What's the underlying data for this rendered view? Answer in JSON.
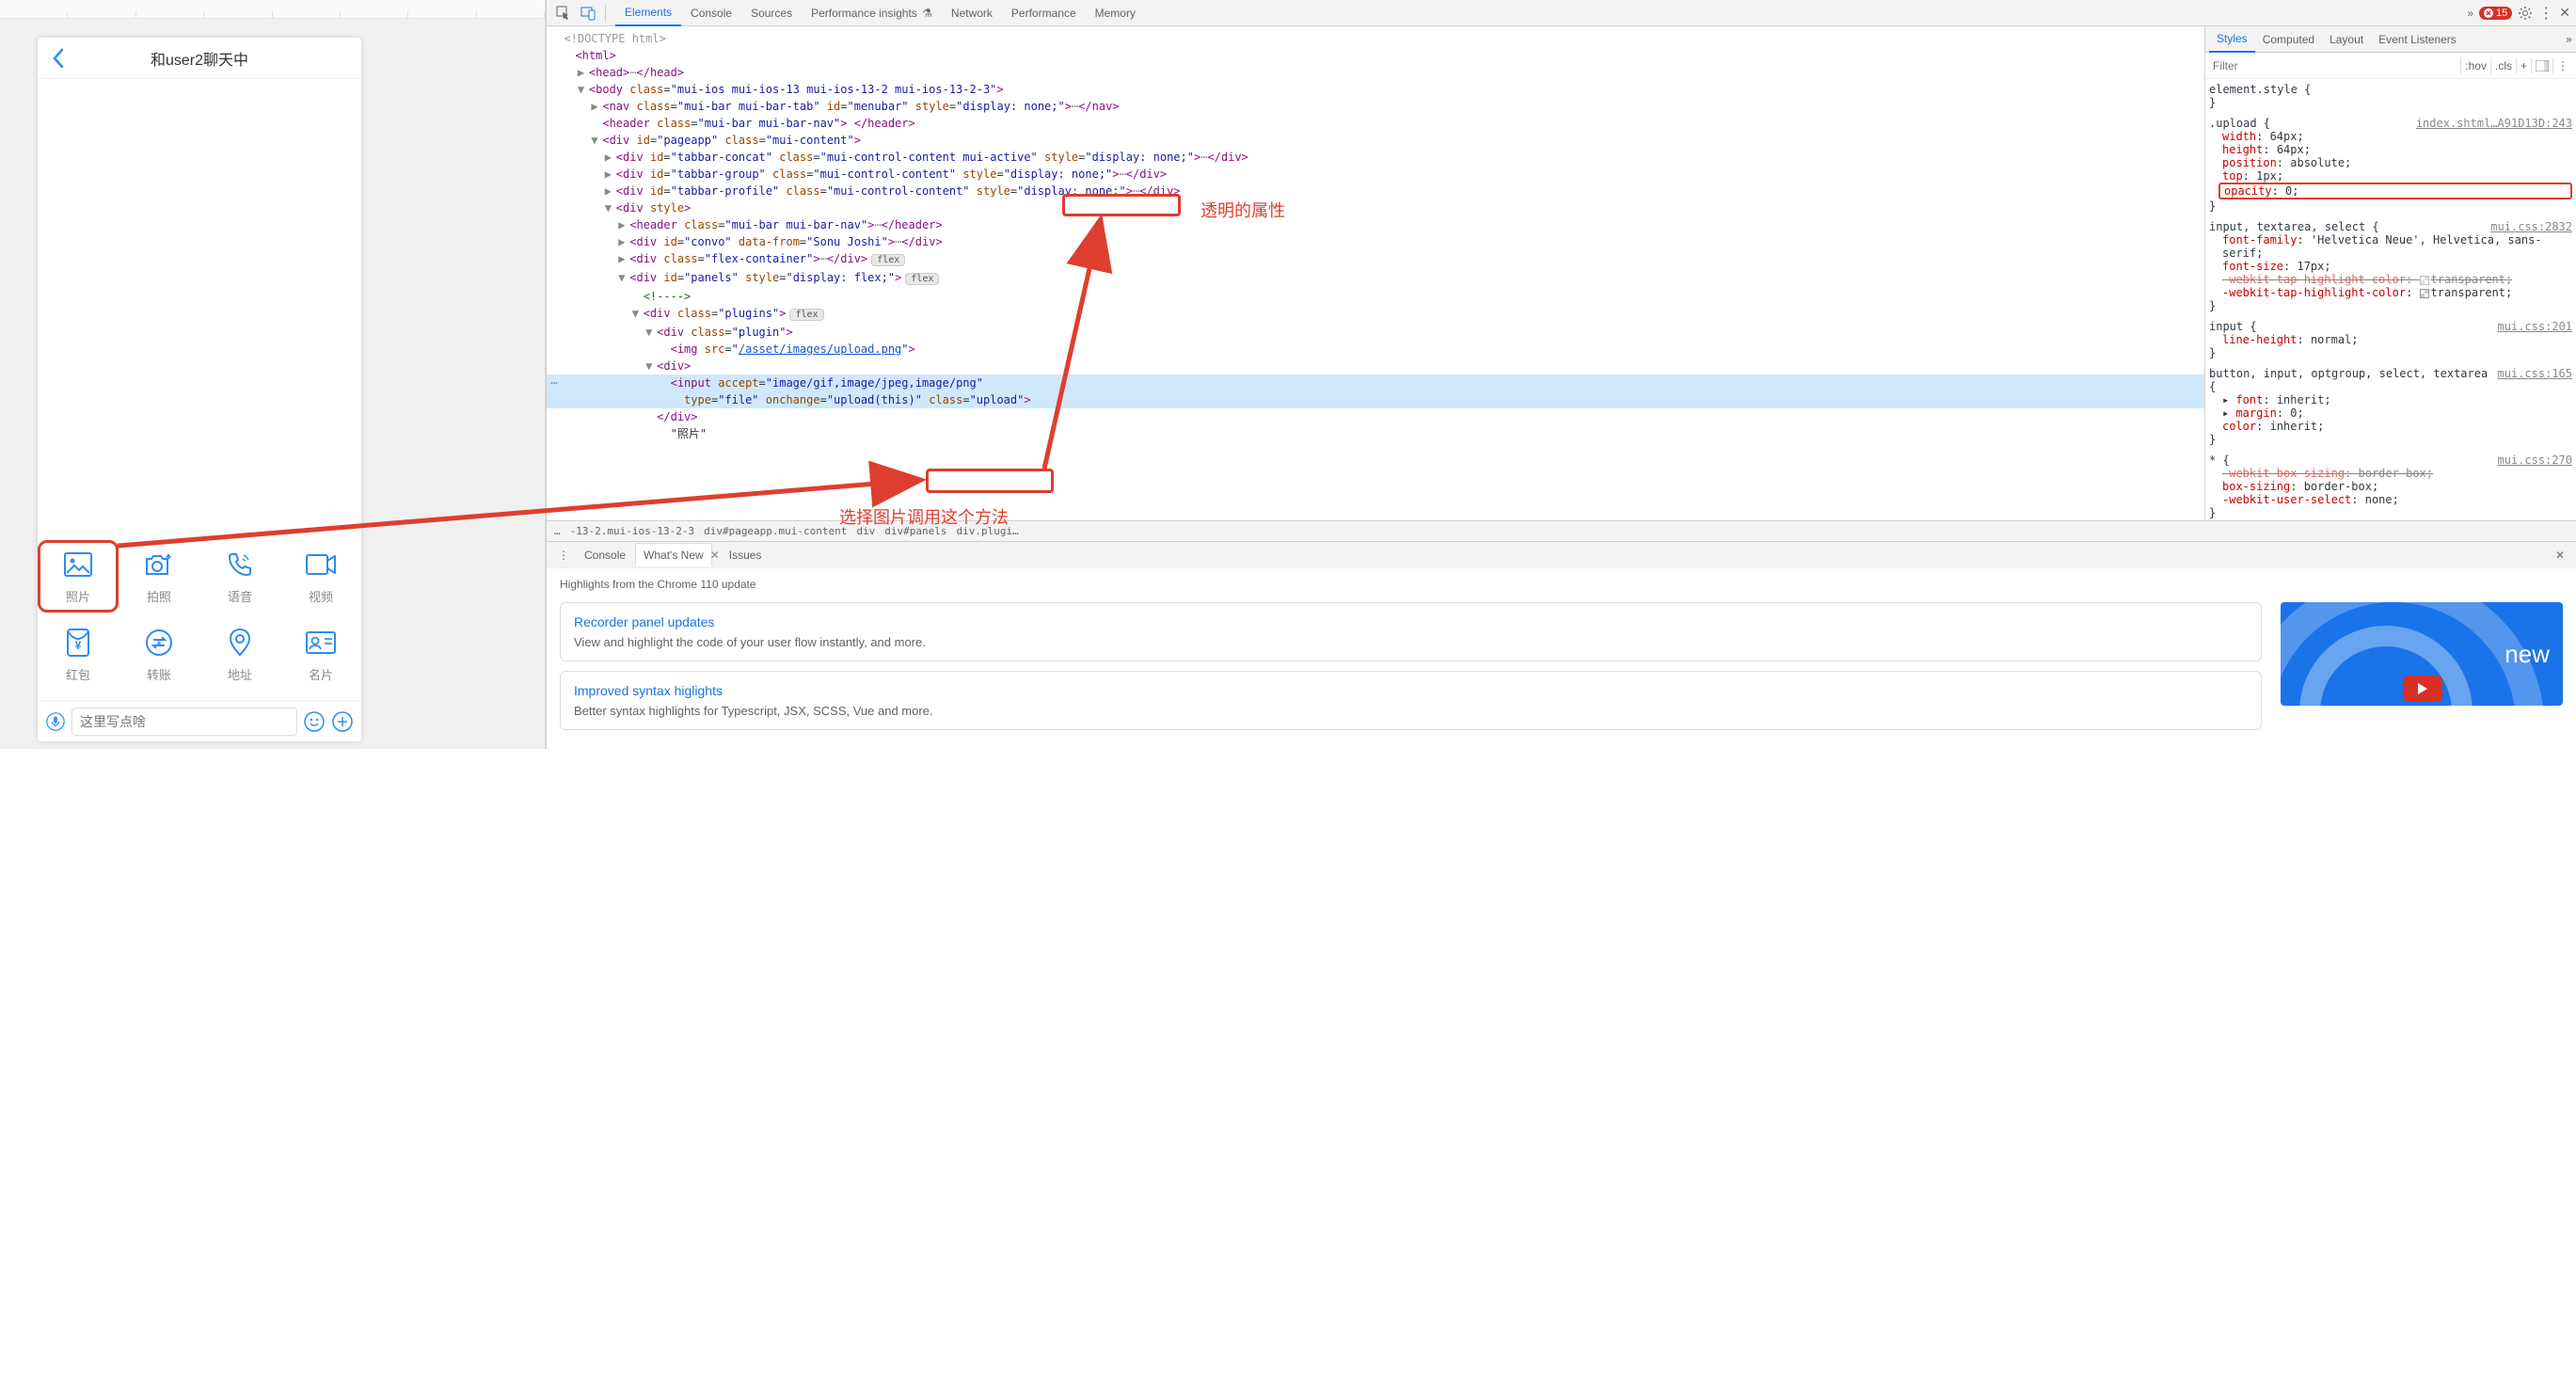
{
  "phone": {
    "title": "和user2聊天中",
    "back_aria": "Back",
    "plugins": [
      {
        "label": "照片",
        "icon": "image-icon",
        "highlight": true
      },
      {
        "label": "拍照",
        "icon": "camera-plus-icon"
      },
      {
        "label": "语音",
        "icon": "phone-sound-icon"
      },
      {
        "label": "视频",
        "icon": "video-icon"
      },
      {
        "label": "红包",
        "icon": "red-envelope-icon"
      },
      {
        "label": "转账",
        "icon": "transfer-icon"
      },
      {
        "label": "地址",
        "icon": "location-icon"
      },
      {
        "label": "名片",
        "icon": "contact-card-icon"
      }
    ],
    "input_placeholder": "这里写点啥"
  },
  "devtools": {
    "tabs": [
      "Elements",
      "Console",
      "Sources",
      "Performance insights",
      "Network",
      "Performance",
      "Memory"
    ],
    "active_tab": "Elements",
    "more_tabs": "»",
    "error_count": "15",
    "dom": {
      "doctype": "<!DOCTYPE html>",
      "lines": [
        {
          "indent": 0,
          "arrow": "",
          "html": "<span class='tag'>&lt;html&gt;</span>"
        },
        {
          "indent": 1,
          "arrow": "▶",
          "html": "<span class='tag'>&lt;head&gt;</span><span class='ellipsis-badge'>⋯</span><span class='tag'>&lt;/head&gt;</span>"
        },
        {
          "indent": 1,
          "arrow": "▼",
          "html": "<span class='tag'>&lt;body</span> <span class='attr-name'>class</span>=<span class='attr-value'>\"mui-ios mui-ios-13 mui-ios-13-2 mui-ios-13-2-3\"</span><span class='tag'>&gt;</span>"
        },
        {
          "indent": 2,
          "arrow": "▶",
          "html": "<span class='tag'>&lt;nav</span> <span class='attr-name'>class</span>=<span class='attr-value'>\"mui-bar mui-bar-tab\"</span> <span class='attr-name'>id</span>=<span class='attr-value'>\"menubar\"</span> <span class='attr-name'>style</span>=<span class='attr-value'>\"display: none;\"</span><span class='tag'>&gt;</span><span class='ellipsis-badge'>⋯</span><span class='tag'>&lt;/nav&gt;</span>"
        },
        {
          "indent": 2,
          "arrow": "",
          "html": "<span class='tag'>&lt;header</span> <span class='attr-name'>class</span>=<span class='attr-value'>\"mui-bar mui-bar-nav\"</span><span class='tag'>&gt;</span> <span class='tag'>&lt;/header&gt;</span>"
        },
        {
          "indent": 2,
          "arrow": "▼",
          "html": "<span class='tag'>&lt;div</span> <span class='attr-name'>id</span>=<span class='attr-value'>\"pageapp\"</span> <span class='attr-name'>class</span>=<span class='attr-value'>\"mui-content\"</span><span class='tag'>&gt;</span>"
        },
        {
          "indent": 3,
          "arrow": "▶",
          "html": "<span class='tag'>&lt;div</span> <span class='attr-name'>id</span>=<span class='attr-value'>\"tabbar-concat\"</span> <span class='attr-name'>class</span>=<span class='attr-value'>\"mui-control-content mui-active\"</span> <span class='attr-name'>style</span>=<span class='attr-value'>\"display: none;\"</span><span class='tag'>&gt;</span><span class='ellipsis-badge'>⋯</span><span class='tag'>&lt;/div&gt;</span>"
        },
        {
          "indent": 3,
          "arrow": "▶",
          "html": "<span class='tag'>&lt;div</span> <span class='attr-name'>id</span>=<span class='attr-value'>\"tabbar-group\"</span> <span class='attr-name'>class</span>=<span class='attr-value'>\"mui-control-content\"</span> <span class='attr-name'>style</span>=<span class='attr-value'>\"display: none;\"</span><span class='tag'>&gt;</span><span class='ellipsis-badge'>⋯</span><span class='tag'>&lt;/div&gt;</span>"
        },
        {
          "indent": 3,
          "arrow": "▶",
          "html": "<span class='tag'>&lt;div</span> <span class='attr-name'>id</span>=<span class='attr-value'>\"tabbar-profile\"</span> <span class='attr-name'>class</span>=<span class='attr-value'>\"mui-control-content\"</span> <span class='attr-name'>style</span>=<span class='attr-value'>\"display: none;\"</span><span class='tag'>&gt;</span><span class='ellipsis-badge'>⋯</span><span class='tag'>&lt;/div&gt;</span>"
        },
        {
          "indent": 3,
          "arrow": "▼",
          "html": "<span class='tag'>&lt;div</span> <span class='attr-name'>style</span><span class='tag'>&gt;</span>"
        },
        {
          "indent": 4,
          "arrow": "▶",
          "html": "<span class='tag'>&lt;header</span> <span class='attr-name'>class</span>=<span class='attr-value'>\"mui-bar mui-bar-nav\"</span><span class='tag'>&gt;</span><span class='ellipsis-badge'>⋯</span><span class='tag'>&lt;/header&gt;</span>"
        },
        {
          "indent": 4,
          "arrow": "▶",
          "html": "<span class='tag'>&lt;div</span> <span class='attr-name'>id</span>=<span class='attr-value'>\"convo\"</span> <span class='attr-name'>data-from</span>=<span class='attr-value'>\"Sonu Joshi\"</span><span class='tag'>&gt;</span><span class='ellipsis-badge'>⋯</span><span class='tag'>&lt;/div&gt;</span>"
        },
        {
          "indent": 4,
          "arrow": "▶",
          "html": "<span class='tag'>&lt;div</span> <span class='attr-name'>class</span>=<span class='attr-value'>\"flex-container\"</span><span class='tag'>&gt;</span><span class='ellipsis-badge'>⋯</span><span class='tag'>&lt;/div&gt;</span><span class='flex-badge'>flex</span>"
        },
        {
          "indent": 4,
          "arrow": "▼",
          "html": "<span class='tag'>&lt;div</span> <span class='attr-name'>id</span>=<span class='attr-value'>\"panels\"</span> <span class='attr-name'>style</span>=<span class='attr-value'>\"display: flex;\"</span><span class='tag'>&gt;</span><span class='flex-badge'>flex</span>"
        },
        {
          "indent": 5,
          "arrow": "",
          "html": "<span class='comment'>&lt;!----&gt;</span>"
        },
        {
          "indent": 5,
          "arrow": "▼",
          "html": "<span class='tag'>&lt;div</span> <span class='attr-name'>class</span>=<span class='attr-value'>\"plugins\"</span><span class='tag'>&gt;</span><span class='flex-badge'>flex</span>"
        },
        {
          "indent": 6,
          "arrow": "▼",
          "html": "<span class='tag'>&lt;div</span> <span class='attr-name'>class</span>=<span class='attr-value'>\"plugin\"</span><span class='tag'>&gt;</span>"
        },
        {
          "indent": 7,
          "arrow": "",
          "html": "<span class='tag'>&lt;img</span> <span class='attr-name'>src</span>=<span class='attr-value'>\"<span class='url-link'>/asset/images/upload.png</span>\"</span><span class='tag'>&gt;</span>"
        },
        {
          "indent": 6,
          "arrow": "▼",
          "html": "<span class='tag'>&lt;div&gt;</span>"
        },
        {
          "indent": 7,
          "arrow": "",
          "sel": true,
          "html": "<span class='tag'>&lt;input</span> <span class='attr-name'>accept</span>=<span class='attr-value'>\"image/gif,image/jpeg,image/png\"</span>"
        },
        {
          "indent": 8,
          "arrow": "",
          "sel": true,
          "html": "<span class='attr-name'>type</span>=<span class='attr-value'>\"file\"</span> <span class='attr-name'>onchange</span>=<span class='attr-value'>\"upload(this)\"</span> <span class='attr-name'>class</span>=<span class='attr-value'>\"upload\"</span><span class='tag'>&gt;</span>"
        },
        {
          "indent": 6,
          "arrow": "",
          "html": "<span class='tag'>&lt;/div&gt;</span>"
        },
        {
          "indent": 7,
          "arrow": "",
          "html": "\"照片\""
        }
      ]
    },
    "breadcrumb": [
      "…",
      "-13-2.mui-ios-13-2-3",
      "div#pageapp.mui-content",
      "div",
      "div#panels",
      "div.plugi…"
    ],
    "styles": {
      "tabs": [
        "Styles",
        "Computed",
        "Layout",
        "Event Listeners"
      ],
      "active": "Styles",
      "filter_placeholder": "Filter",
      "hov": ":hov",
      "cls": ".cls",
      "rules": [
        {
          "selector": "element.style",
          "src": "",
          "props": []
        },
        {
          "selector": ".upload",
          "src": "index.shtml…A91D13D:243",
          "props": [
            {
              "n": "width",
              "v": "64px"
            },
            {
              "n": "height",
              "v": "64px"
            },
            {
              "n": "position",
              "v": "absolute"
            },
            {
              "n": "top",
              "v": "1px"
            },
            {
              "n": "opacity",
              "v": "0",
              "box": true
            }
          ]
        },
        {
          "selector": "input, textarea, select",
          "src": "mui.css:2832",
          "props": [
            {
              "n": "font-family",
              "v": "'Helvetica Neue', Helvetica, sans-serif"
            },
            {
              "n": "font-size",
              "v": "17px"
            },
            {
              "n": "-webkit-tap-highlight-color",
              "v": "transparent",
              "strike": true,
              "swatch": true
            },
            {
              "n": "-webkit-tap-highlight-color",
              "v": "transparent",
              "swatch": true
            }
          ]
        },
        {
          "selector": "input",
          "src": "mui.css:201",
          "props": [
            {
              "n": "line-height",
              "v": "normal"
            }
          ]
        },
        {
          "selector": "button, input, optgroup, select, textarea",
          "src": "mui.css:165",
          "props": [
            {
              "n": "font",
              "v": "inherit",
              "expand": true
            },
            {
              "n": "margin",
              "v": "0",
              "expand": true
            },
            {
              "n": "color",
              "v": "inherit"
            }
          ]
        },
        {
          "selector": "*",
          "src": "mui.css:270",
          "props": [
            {
              "n": "-webkit-box-sizing",
              "v": "border-box",
              "strike": true
            },
            {
              "n": "box-sizing",
              "v": "border-box"
            },
            {
              "n": "-webkit-user-select",
              "v": "none"
            }
          ]
        }
      ]
    },
    "drawer": {
      "tabs": [
        "Console",
        "What's New",
        "Issues"
      ],
      "active": "What's New",
      "heading": "Highlights from the Chrome 110 update",
      "cards": [
        {
          "title": "Recorder panel updates",
          "desc": "View and highlight the code of your user flow instantly, and more."
        },
        {
          "title": "Improved syntax higlights",
          "desc": "Better syntax highlights for Typescript, JSX, SCSS, Vue and more."
        }
      ],
      "promo_text": "new"
    }
  },
  "annotations": {
    "opacity_label": "透明的属性",
    "method_label": "选择图片调用这个方法"
  }
}
